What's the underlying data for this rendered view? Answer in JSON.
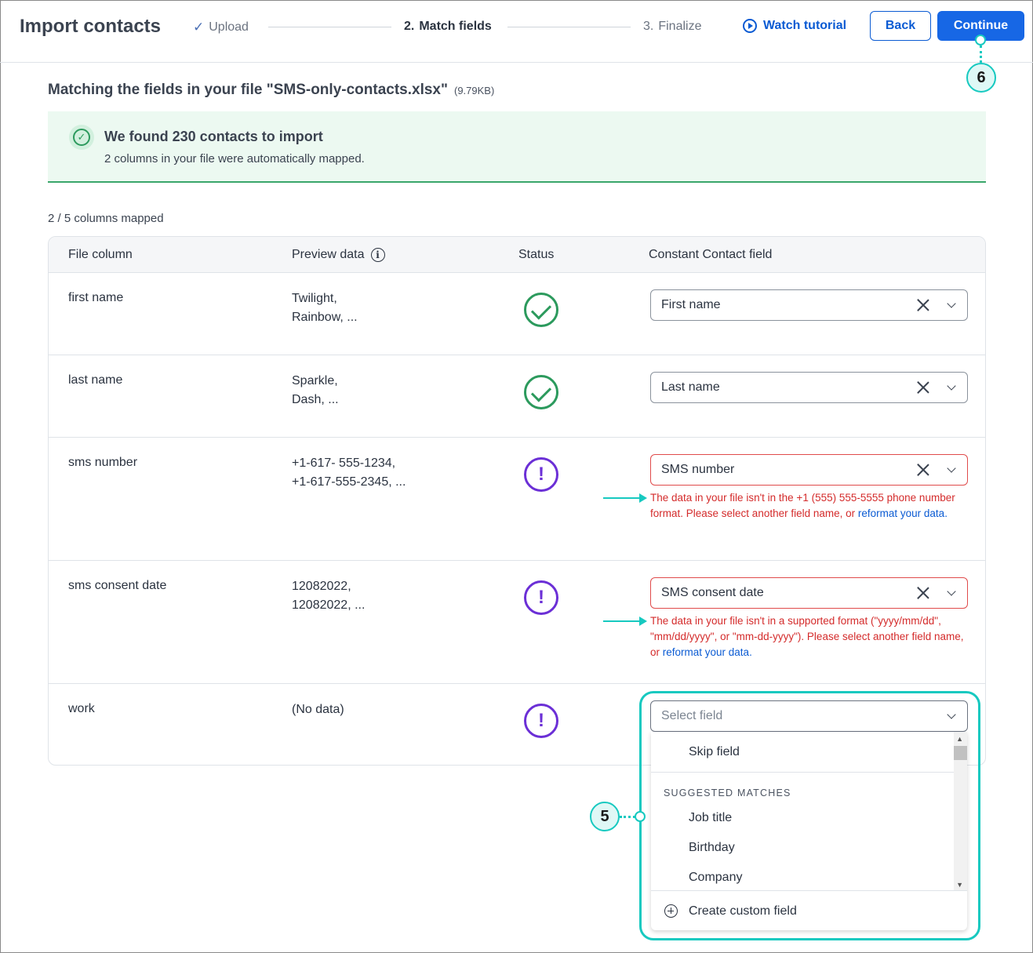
{
  "header": {
    "title": "Import contacts",
    "steps": [
      {
        "label": "Upload",
        "prefix": "✓",
        "state": "done"
      },
      {
        "label": "Match fields",
        "prefix": "2.",
        "state": "active"
      },
      {
        "label": "Finalize",
        "prefix": "3.",
        "state": "pending"
      }
    ],
    "tutorial_label": "Watch tutorial",
    "back_label": "Back",
    "continue_label": "Continue"
  },
  "callouts": {
    "continue": "6",
    "dropdown": "5"
  },
  "main": {
    "match_title": "Matching the fields in your file \"SMS-only-contacts.xlsx\"",
    "file_size": "(9.79KB)",
    "banner": {
      "title": "We found 230 contacts to import",
      "subtitle": "2 columns in your file were automatically mapped."
    },
    "mapped_count": "2 / 5 columns mapped"
  },
  "table": {
    "headers": [
      "File column",
      "Preview data",
      "Status",
      "Constant Contact field"
    ],
    "rows": [
      {
        "column": "first name",
        "preview1": "Twilight,",
        "preview2": "Rainbow, ...",
        "status": "ok",
        "field": "First name"
      },
      {
        "column": "last name",
        "preview1": "Sparkle,",
        "preview2": "Dash, ...",
        "status": "ok",
        "field": "Last name"
      },
      {
        "column": "sms number",
        "preview1": "+1-617- 555-1234,",
        "preview2": "+1-617-555-2345, ...",
        "status": "warning",
        "field": "SMS number",
        "error_text": "The data in your file isn't in the +1 (555) 555-5555 phone number format. Please select another field name, or ",
        "error_link": "reformat your data",
        "error_end": "."
      },
      {
        "column": "sms consent date",
        "preview1": "12082022,",
        "preview2": "12082022, ...",
        "status": "warning",
        "field": "SMS consent date",
        "error_text": "The data in your file isn't in a supported format (\"yyyy/mm/dd\", \"mm/dd/yyyy\", or \"mm-dd-yyyy\"). Please select another field name, or ",
        "error_link": "reformat your data",
        "error_end": "."
      },
      {
        "column": "work",
        "preview1": "(No data)",
        "preview2": "",
        "status": "warning",
        "field_placeholder": "Select field"
      }
    ]
  },
  "dropdown": {
    "skip": "Skip field",
    "section_heading": "SUGGESTED MATCHES",
    "options": [
      "Job title",
      "Birthday",
      "Company"
    ],
    "create_custom": "Create custom field"
  },
  "colors": {
    "accent": "#1767e5",
    "success": "#2c9a5d",
    "warning": "#6b2fd6",
    "error": "#d42b2b",
    "callout": "#17c9c0"
  }
}
